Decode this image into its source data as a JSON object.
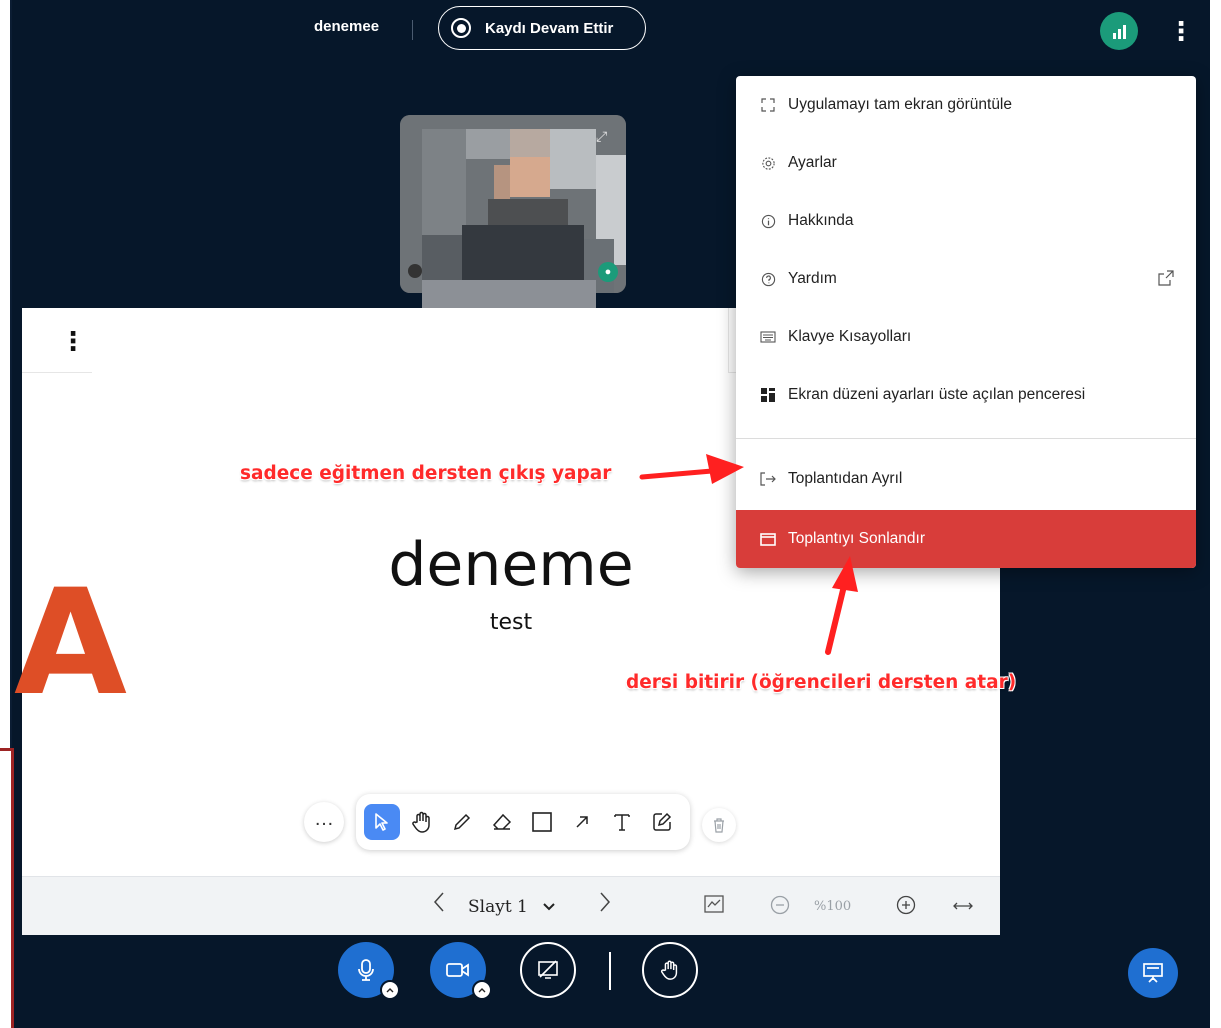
{
  "header": {
    "meeting_name": "denemee",
    "record_label": "Kaydı Devam Ettir"
  },
  "menu": {
    "items": [
      {
        "label": "Uygulamayı tam ekran görüntüle",
        "icon": "fullscreen-icon"
      },
      {
        "label": "Ayarlar",
        "icon": "gear-icon"
      },
      {
        "label": "Hakkında",
        "icon": "info-icon"
      },
      {
        "label": "Yardım",
        "icon": "help-icon"
      },
      {
        "label": "Klavye Kısayolları",
        "icon": "keyboard-icon"
      },
      {
        "label": "Ekran düzeni ayarları üste açılan penceresi",
        "icon": "layout-icon"
      },
      {
        "label": "Toplantıdan Ayrıl",
        "icon": "logout-icon"
      },
      {
        "label": "Toplantıyı Sonlandır",
        "icon": "end-meeting-icon"
      }
    ]
  },
  "slide": {
    "title": "deneme",
    "subtitle": "test"
  },
  "footer": {
    "slide_selector": "Slayt 1",
    "zoom": "%100"
  },
  "annotations": {
    "leave_note": "sadece eğitmen dersten çıkış yapar",
    "end_note": "dersi bitirir (öğrencileri dersten atar)",
    "big_letter": "A"
  },
  "colors": {
    "app_bg": "#06172a",
    "accent_blue": "#1f6fd1",
    "danger_red": "#d83d3a",
    "connection_green": "#1b9b7a",
    "annotation_red": "#ff2a2a",
    "letter_orange": "#de4e26"
  }
}
